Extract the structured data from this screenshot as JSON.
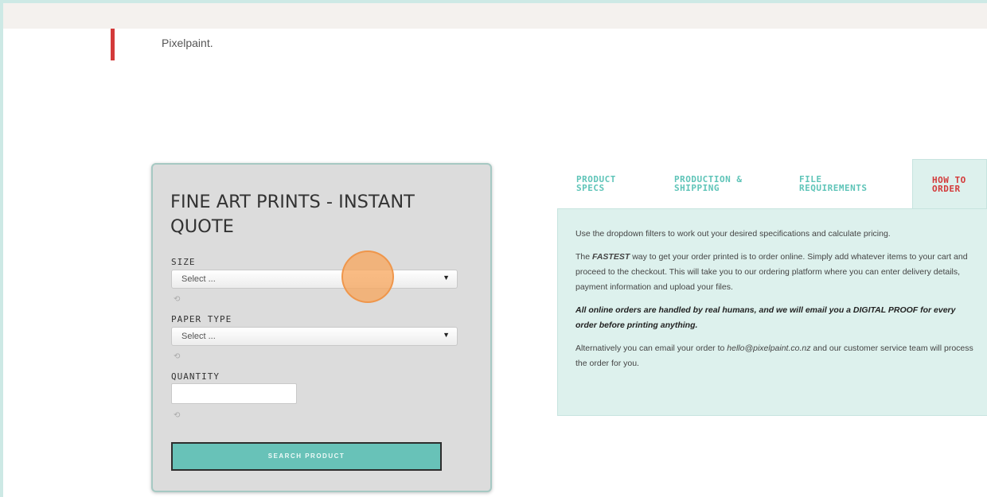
{
  "pullquote": {
    "text": "Pixelpaint."
  },
  "quote_form": {
    "title": "FINE ART PRINTS - INSTANT QUOTE",
    "size": {
      "label": "SIZE",
      "value": "Select ..."
    },
    "paper_type": {
      "label": "PAPER TYPE",
      "value": "Select ..."
    },
    "quantity": {
      "label": "QUANTITY",
      "value": ""
    },
    "help_glyph": "⟲",
    "search_button": "SEARCH PRODUCT"
  },
  "tabs": [
    {
      "label": "PRODUCT\nSPECS",
      "active": false
    },
    {
      "label": "PRODUCTION &\nSHIPPING",
      "active": false
    },
    {
      "label": "FILE\nREQUIREMENTS",
      "active": false
    },
    {
      "label": "HOW TO\nORDER",
      "active": true
    }
  ],
  "how_to_order": {
    "p1": "Use the dropdown filters to work out your desired specifications and calculate pricing.",
    "p2_pre": "The ",
    "p2_em": "FASTEST",
    "p2_post": " way to get your order printed is to order online. Simply add whatever items to your cart and proceed to the checkout. This will take you to our ordering platform where you can enter delivery details, payment information and upload your files.",
    "p3": "All online orders are handled by real humans, and we will email you a DIGITAL PROOF for every order before printing anything.",
    "p4_pre": "Alternatively you can email your order to ",
    "p4_email": "hello@pixelpaint.co.nz",
    "p4_post": " and our customer service team will process the order for you."
  },
  "colors": {
    "accent_teal": "#5ec4b8",
    "accent_red": "#d33a3a",
    "panel_bg": "#ddf1ed",
    "button_bg": "#68c2b8"
  }
}
